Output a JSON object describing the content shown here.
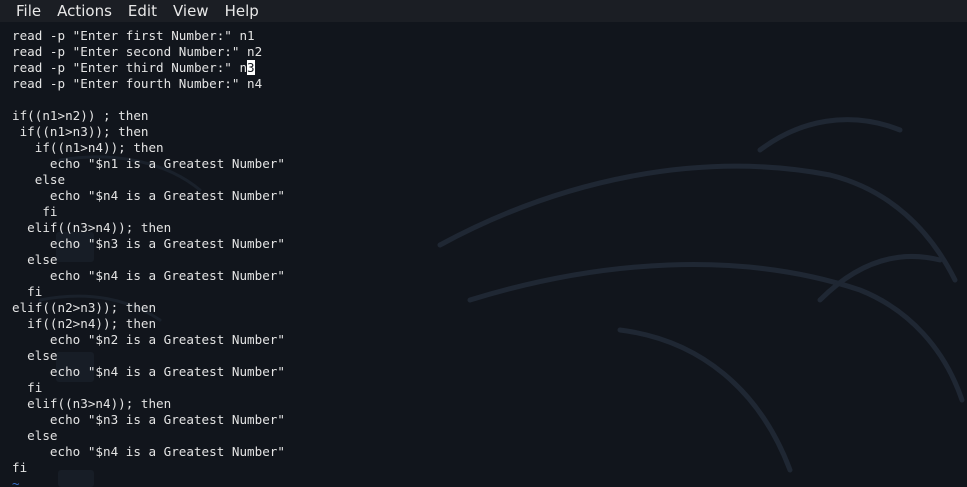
{
  "menubar": {
    "items": [
      "File",
      "Actions",
      "Edit",
      "View",
      "Help"
    ]
  },
  "editor": {
    "lines": [
      "read -p \"Enter first Number:\" n1",
      "read -p \"Enter second Number:\" n2",
      "read -p \"Enter third Number:\" n",
      "read -p \"Enter fourth Number:\" n4",
      "",
      "if((n1>n2)) ; then",
      " if((n1>n3)); then",
      "   if((n1>n4)); then",
      "     echo \"$n1 is a Greatest Number\"",
      "   else",
      "     echo \"$n4 is a Greatest Number\"",
      "    fi",
      "  elif((n3>n4)); then",
      "     echo \"$n3 is a Greatest Number\"",
      "  else",
      "     echo \"$n4 is a Greatest Number\"",
      "  fi",
      "elif((n2>n3)); then",
      "  if((n2>n4)); then",
      "     echo \"$n2 is a Greatest Number\"",
      "  else",
      "     echo \"$n4 is a Greatest Number\"",
      "  fi",
      "  elif((n3>n4)); then",
      "     echo \"$n3 is a Greatest Number\"",
      "  else",
      "     echo \"$n4 is a Greatest Number\"",
      "fi"
    ],
    "cursor_char": "3",
    "empty_line_marker": "~"
  },
  "colors": {
    "background": "#11151c",
    "menubar": "#1b1e24",
    "text": "#e4e4e4",
    "tilde": "#3b6fc9"
  }
}
